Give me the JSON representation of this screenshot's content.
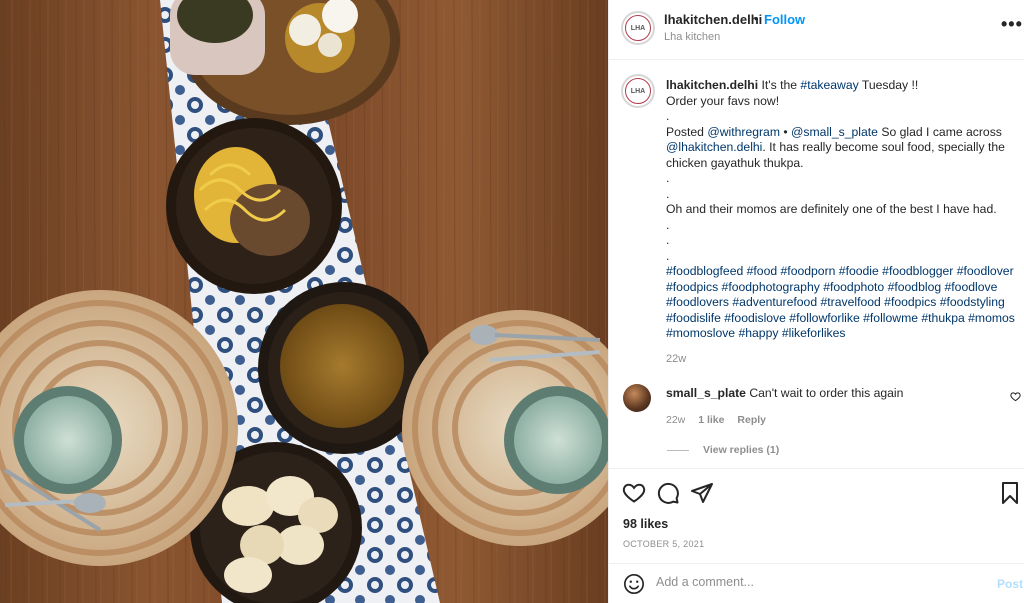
{
  "post": {
    "username": "lhakitchen.delhi",
    "separator": "•",
    "follow_label": "Follow",
    "location": "Lha kitchen",
    "avatar_text": "LHA",
    "more_label": "•••"
  },
  "caption": {
    "username": "lhakitchen.delhi",
    "line1_pre": "It's the ",
    "line1_tag": "#takeaway",
    "line1_post": " Tuesday !!",
    "line2": "Order your favs now!",
    "dot": ".",
    "posted_pre": "Posted ",
    "posted_mention1": "@withregram",
    "posted_sep": " • ",
    "posted_mention2": "@small_s_plate",
    "posted_post": " So glad I came across ",
    "posted_mention3": "@lhakitchen.delhi",
    "posted_rest": ". It has really become soul food, specially the chicken gayathuk thukpa.",
    "momos_line": "Oh and their momos are definitely one of the best I have had.",
    "hashtags": "#foodblogfeed #food #foodporn #foodie #foodblogger #foodlover #foodpics #foodphotography #foodphoto #foodblog #foodlove #foodlovers #adventurefood #travelfood #foodpics #foodstyling #foodislife #foodislove #followforlike #followme #thukpa #momos #momoslove #happy #likeforlikes",
    "age": "22w"
  },
  "comment": {
    "username": "small_s_plate",
    "text": "Can't wait to order this again",
    "age": "22w",
    "likes": "1 like",
    "reply_label": "Reply",
    "view_replies": "View replies (1)"
  },
  "actions": {
    "like_icon": "heart-icon",
    "comment_icon": "comment-icon",
    "share_icon": "share-icon",
    "save_icon": "bookmark-icon",
    "likes": "98 likes",
    "date": "OCTOBER 5, 2021"
  },
  "add_comment": {
    "emoji_icon": "emoji-icon",
    "placeholder": "Add a comment...",
    "post_label": "Post"
  },
  "colors": {
    "link": "#00376b",
    "follow": "#0095f6",
    "muted": "#8e8e8e"
  }
}
